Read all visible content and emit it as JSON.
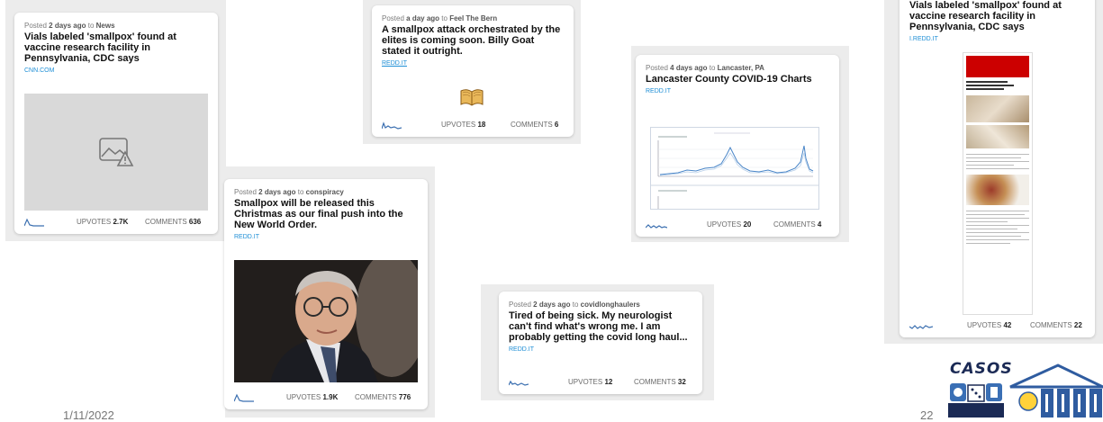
{
  "cards": {
    "c1": {
      "posted": "Posted",
      "age": "2 days ago",
      "to": "to",
      "sub": "News",
      "title": "Vials labeled 'smallpox' found at vaccine research facility in Pennsylvania, CDC says",
      "domain": "CNN.COM",
      "up_label": "UPVOTES",
      "up": "2.7K",
      "cm_label": "COMMENTS",
      "cm": "636"
    },
    "c2": {
      "posted": "Posted",
      "age": "a day ago",
      "to": "to",
      "sub": "Feel The Bern",
      "title": "A smallpox attack orchestrated by the elites is coming soon. Billy Goat stated it outright.",
      "domain": "REDD.IT",
      "up_label": "UPVOTES",
      "up": "18",
      "cm_label": "COMMENTS",
      "cm": "6"
    },
    "c3": {
      "posted": "Posted",
      "age": "4 days ago",
      "to": "to",
      "sub": "Lancaster, PA",
      "title": "Lancaster County COVID-19 Charts",
      "domain": "REDD.IT",
      "up_label": "UPVOTES",
      "up": "20",
      "cm_label": "COMMENTS",
      "cm": "4"
    },
    "c4": {
      "title": "Vials labeled 'smallpox' found at vaccine research facility in Pennsylvania, CDC says",
      "domain": "I.REDD.IT",
      "up_label": "UPVOTES",
      "up": "42",
      "cm_label": "COMMENTS",
      "cm": "22"
    },
    "c5": {
      "posted": "Posted",
      "age": "2 days ago",
      "to": "to",
      "sub": "conspiracy",
      "title": "Smallpox will be released this Christmas as our final push into the New World Order.",
      "domain": "REDD.IT",
      "up_label": "UPVOTES",
      "up": "1.9K",
      "cm_label": "COMMENTS",
      "cm": "776"
    },
    "c6": {
      "posted": "Posted",
      "age": "2 days ago",
      "to": "to",
      "sub": "covidlonghaulers",
      "title": "Tired of being sick. My neurologist can't find what's wrong me. I am probably getting the covid long haul...",
      "domain": "REDD.IT",
      "up_label": "UPVOTES",
      "up": "12",
      "cm_label": "COMMENTS",
      "cm": "32"
    }
  },
  "slide": {
    "date": "1/11/2022",
    "page": "22",
    "logo_text": "CASOS"
  },
  "colors": {
    "accent": "#1f8fd6",
    "spark": "#3b6fb0",
    "cnn_red": "#cc0000"
  }
}
